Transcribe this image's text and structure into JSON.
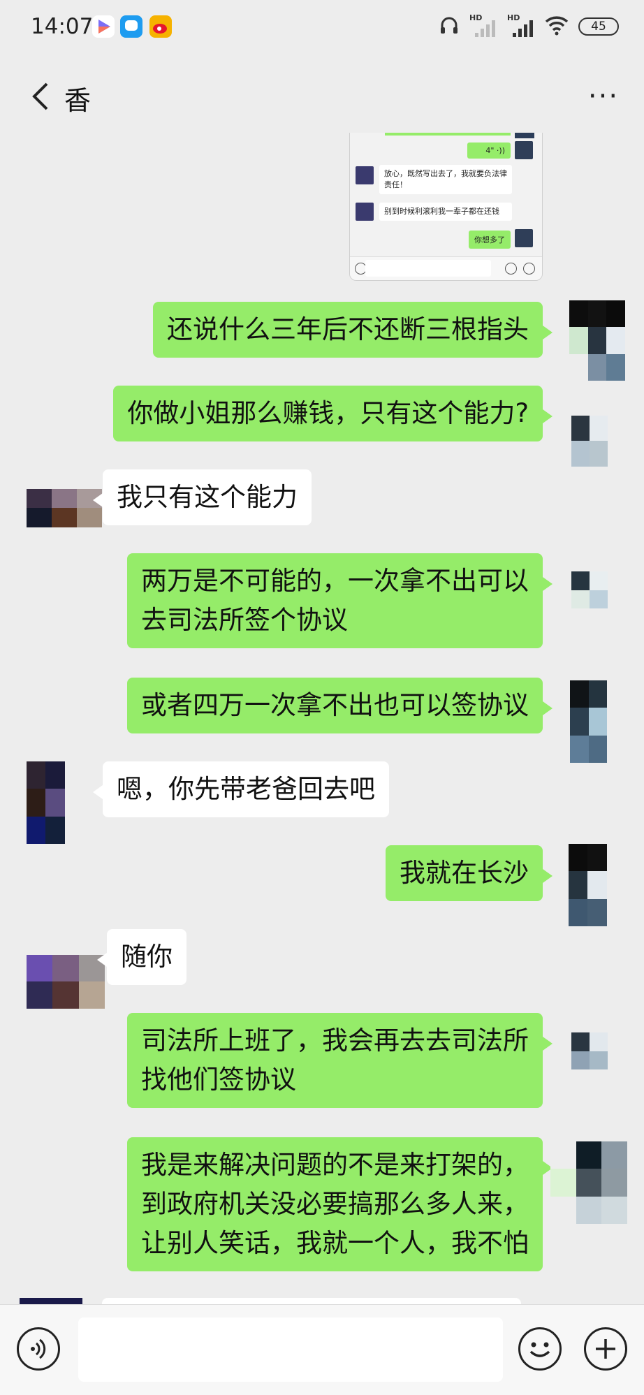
{
  "status_bar": {
    "time": "14:07",
    "battery": "45",
    "signal_label_1": "HD",
    "signal_label_2": "HD",
    "icons": [
      "video-app-icon",
      "message-app-icon",
      "weibo-app-icon",
      "headphones-icon",
      "signal-icon",
      "signal-icon",
      "wifi-icon",
      "battery-icon"
    ]
  },
  "header": {
    "title": "香",
    "more_label": "···"
  },
  "screenshot": {
    "voice_duration": "4\"",
    "messages": [
      "放心，既然写出去了，我就要负法律责任！",
      "别到时候利滚利我一辈子都在还钱",
      "你想多了"
    ]
  },
  "messages": [
    {
      "side": "right",
      "lines": [
        "还说什么三年后不还断三根指头"
      ]
    },
    {
      "side": "right",
      "lines": [
        "你做小姐那么赚钱，只有这个能力?"
      ]
    },
    {
      "side": "left",
      "lines": [
        "我只有这个能力"
      ]
    },
    {
      "side": "right",
      "lines": [
        "两万是不可能的，一次拿不出可以",
        "去司法所签个协议"
      ]
    },
    {
      "side": "right",
      "lines": [
        "或者四万一次拿不出也可以签协议"
      ]
    },
    {
      "side": "left",
      "lines": [
        "嗯，你先带老爸回去吧"
      ]
    },
    {
      "side": "right",
      "lines": [
        "我就在长沙"
      ]
    },
    {
      "side": "left",
      "lines": [
        "随你"
      ]
    },
    {
      "side": "right",
      "lines": [
        "司法所上班了，我会再去去司法所",
        "找他们签协议"
      ]
    },
    {
      "side": "right",
      "lines": [
        "我是来解决问题的不是来打架的，",
        "到政府机关没必要搞那么多人来，",
        "让别人笑话，我就一个人，我不怕"
      ]
    }
  ],
  "input_bar": {
    "input_value": "",
    "icons": [
      "voice-icon",
      "emoji-icon",
      "plus-icon"
    ]
  },
  "colors": {
    "background": "#ededed",
    "bubble_green": "#95ec69",
    "bubble_white": "#ffffff"
  }
}
